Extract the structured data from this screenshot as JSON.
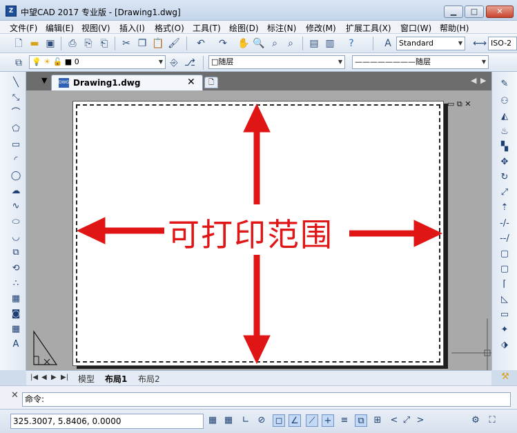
{
  "window": {
    "title": "中望CAD 2017 专业版 - [Drawing1.dwg]",
    "min_label": "▁",
    "max_label": "□",
    "close_label": "✕"
  },
  "menu": [
    "文件(F)",
    "编辑(E)",
    "视图(V)",
    "插入(I)",
    "格式(O)",
    "工具(T)",
    "绘图(D)",
    "标注(N)",
    "修改(M)",
    "扩展工具(X)",
    "窗口(W)",
    "帮助(H)"
  ],
  "toolbar": {
    "text_style": "Standard",
    "dim_style": "ISO-2",
    "layer": "0",
    "color": "□随层",
    "linetype": "————————随层"
  },
  "document": {
    "tab_title": "Drawing1.dwg",
    "tab_close": "✕",
    "doc_icon_text": "DWG",
    "printable_area_label": "可打印范围"
  },
  "layouts": {
    "nav": [
      "|◀",
      "◀",
      "▶",
      "▶|"
    ],
    "tabs": [
      "模型",
      "布局1",
      "布局2"
    ],
    "active": "布局1"
  },
  "command": {
    "prompt": "命令:"
  },
  "status": {
    "coordinates": "325.3007, 5.8406, 0.0000"
  },
  "colors": {
    "annotation_red": "#e01616",
    "canvas_gray": "#a9a9a9"
  }
}
